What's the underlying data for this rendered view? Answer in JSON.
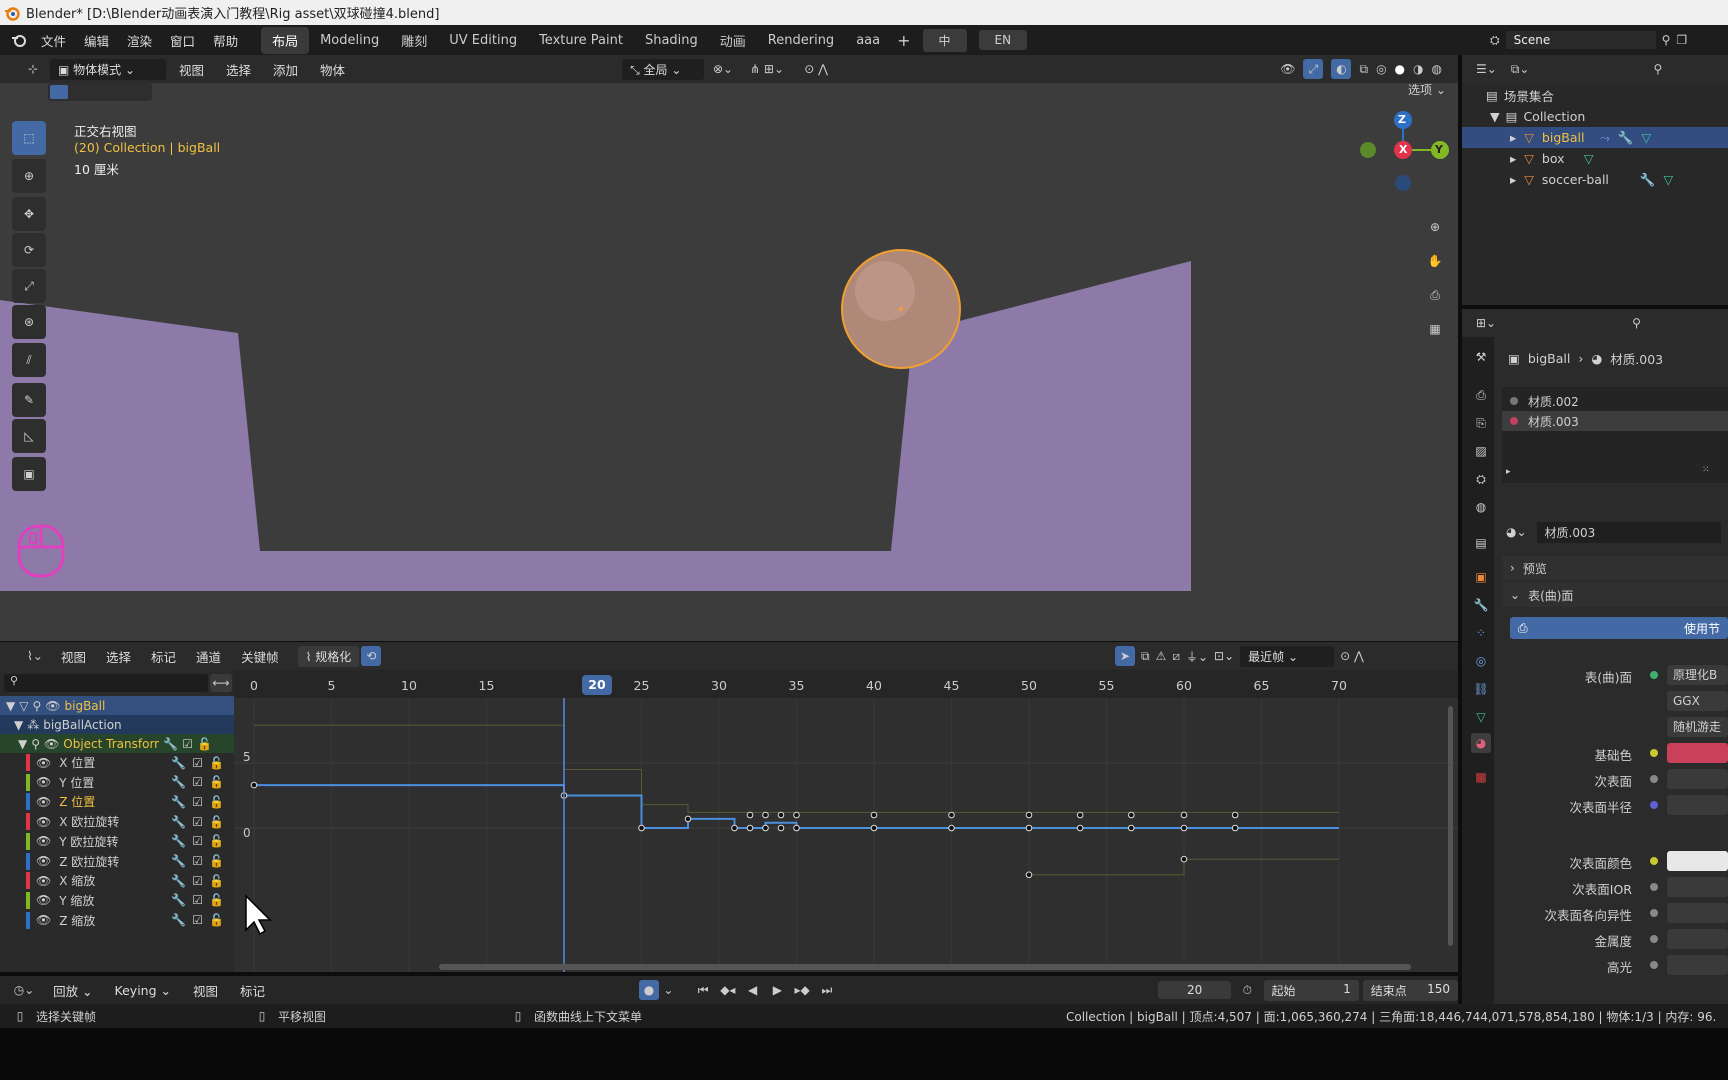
{
  "window": {
    "title": "Blender* [D:\\Blender动画表演入门教程\\Rig asset\\双球碰撞4.blend]"
  },
  "topbar": {
    "menus": [
      "文件",
      "编辑",
      "渲染",
      "窗口",
      "帮助"
    ],
    "workspaces": [
      "布局",
      "Modeling",
      "雕刻",
      "UV Editing",
      "Texture Paint",
      "Shading",
      "动画",
      "Rendering",
      "aaa"
    ],
    "active_workspace": "布局",
    "add_symbol": "+",
    "lang_zh": "中",
    "lang_en": "EN",
    "scene_name": "Scene"
  },
  "viewport": {
    "mode": "物体模式",
    "menus": [
      "视图",
      "选择",
      "添加",
      "物体"
    ],
    "transform_orientation": "全局",
    "options_label": "选项",
    "view_name": "正交右视图",
    "collection_info": "(20) Collection | bigBall",
    "scale_info": "10 厘米",
    "gizmo": {
      "x": "X",
      "y": "Y",
      "z": "Z"
    },
    "colors": {
      "ground": "#8d7aa8",
      "bg": "#3c3c3c",
      "x": "#e0344a",
      "y": "#82b826",
      "z": "#2e6fc7"
    }
  },
  "outliner": {
    "root": "场景集合",
    "collection": "Collection",
    "objects": [
      {
        "name": "bigBall",
        "selected": true
      },
      {
        "name": "box",
        "selected": false
      },
      {
        "name": "soccer-ball",
        "selected": false
      }
    ]
  },
  "properties": {
    "breadcrumb_object": "bigBall",
    "breadcrumb_material": "材质.003",
    "material_slots": [
      "材质.002",
      "材质.003"
    ],
    "active_material": "材质.003",
    "preview_label": "预览",
    "surface_label": "表(曲)面",
    "use_nodes_label": "使用节",
    "rows": [
      {
        "label": "表(曲)面",
        "value": "原理化B",
        "dot": "#40b070"
      },
      {
        "label": "",
        "value": "GGX",
        "dot": ""
      },
      {
        "label": "",
        "value": "随机游走",
        "dot": ""
      },
      {
        "label": "基础色",
        "value": "",
        "dot": "#c8c830",
        "swatch": "#c8405a"
      },
      {
        "label": "次表面",
        "value": "",
        "dot": "#888888"
      },
      {
        "label": "次表面半径",
        "value": "",
        "dot": "#6060d0"
      },
      {
        "label": "次表面颜色",
        "value": "",
        "dot": "#c8c830",
        "swatch": "#e8e8e8"
      },
      {
        "label": "次表面IOR",
        "value": "",
        "dot": "#888888"
      },
      {
        "label": "次表面各向异性",
        "value": "",
        "dot": "#888888"
      },
      {
        "label": "金属度",
        "value": "",
        "dot": "#888888"
      },
      {
        "label": "高光",
        "value": "",
        "dot": "#888888"
      }
    ]
  },
  "graph": {
    "menus": [
      "视图",
      "选择",
      "标记",
      "通道",
      "关键帧"
    ],
    "normalize_label": "规格化",
    "interp_label": "最近帧",
    "current_frame": "20",
    "frame_ticks": [
      "0",
      "5",
      "10",
      "15",
      "20",
      "25",
      "30",
      "35",
      "40",
      "45",
      "50",
      "55",
      "60",
      "65",
      "70"
    ],
    "value_ticks": [
      "5",
      "0"
    ],
    "object": "bigBall",
    "action": "bigBallAction",
    "group": "Object Transform",
    "channels": [
      {
        "name": "X 位置",
        "color": "#e0344a"
      },
      {
        "name": "Y 位置",
        "color": "#82b826"
      },
      {
        "name": "Z 位置",
        "color": "#2e6fc7",
        "highlight": true
      },
      {
        "name": "X 欧拉旋转",
        "color": "#e0344a"
      },
      {
        "name": "Y 欧拉旋转",
        "color": "#82b826"
      },
      {
        "name": "Z 欧拉旋转",
        "color": "#2e6fc7"
      },
      {
        "name": "X 缩放",
        "color": "#e0344a"
      },
      {
        "name": "Y 缩放",
        "color": "#82b826"
      },
      {
        "name": "Z 缩放",
        "color": "#2e6fc7"
      }
    ]
  },
  "timeline": {
    "playback": "回放",
    "keying": "Keying",
    "menus": [
      "视图",
      "标记"
    ],
    "current_frame": "20",
    "start_label": "起始",
    "start_value": "1",
    "end_label": "结束点",
    "end_value": "150"
  },
  "statusbar": {
    "hint1": "选择关键帧",
    "hint2": "平移视图",
    "hint3": "函数曲线上下文菜单",
    "stats": "Collection | bigBall | 顶点:4,507 | 面:1,065,360,274 | 三角面:18,446,744,071,578,854,180 | 物体:1/3 | 内存: 96."
  }
}
